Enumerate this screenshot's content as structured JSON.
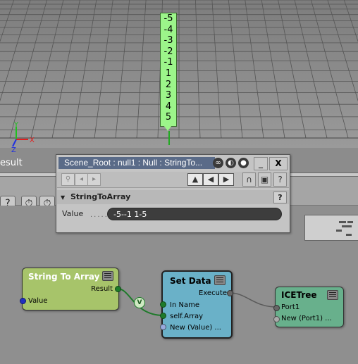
{
  "viewport": {
    "label_values": [
      "-5",
      "-4",
      "-3",
      "-2",
      "-1",
      "1",
      "2",
      "3",
      "4",
      "5"
    ],
    "result_text": "esult",
    "axis_colors": {
      "x": "#e02020",
      "y": "#20c020",
      "z": "#2030e0"
    },
    "axis_labels": {
      "x": "X",
      "y": "Y",
      "z": "Z"
    }
  },
  "toolbar": {
    "help_icon": "?",
    "timer_icon": "⏱",
    "timer2_icon": "⏱"
  },
  "ppg": {
    "title": "Scene_Root : null1 : Null : StringTo...",
    "close_label": "X",
    "min_label": "_",
    "section_title": "StringToArray",
    "help_label": "?",
    "value_label": "Value",
    "value_dots": "......",
    "value_text": "-5--1 1-5",
    "buttons": {
      "back": "◂",
      "forward": "▸",
      "up": "▲",
      "left": "◀",
      "right": "▶"
    }
  },
  "nodes": {
    "string_to_array": {
      "title": "String To Array",
      "output": "Result",
      "input": "Value",
      "color": "#a7c46a"
    },
    "set_data": {
      "title": "Set Data",
      "output": "Execute",
      "inputs": [
        "In Name",
        "self.Array",
        "New (Value) ..."
      ],
      "color": "#6ab1c8"
    },
    "icetree": {
      "title": "ICETree",
      "inputs": [
        "Port1",
        "New (Port1) ..."
      ],
      "color": "#68b08c"
    }
  },
  "connection": {
    "converter_label": "V"
  }
}
